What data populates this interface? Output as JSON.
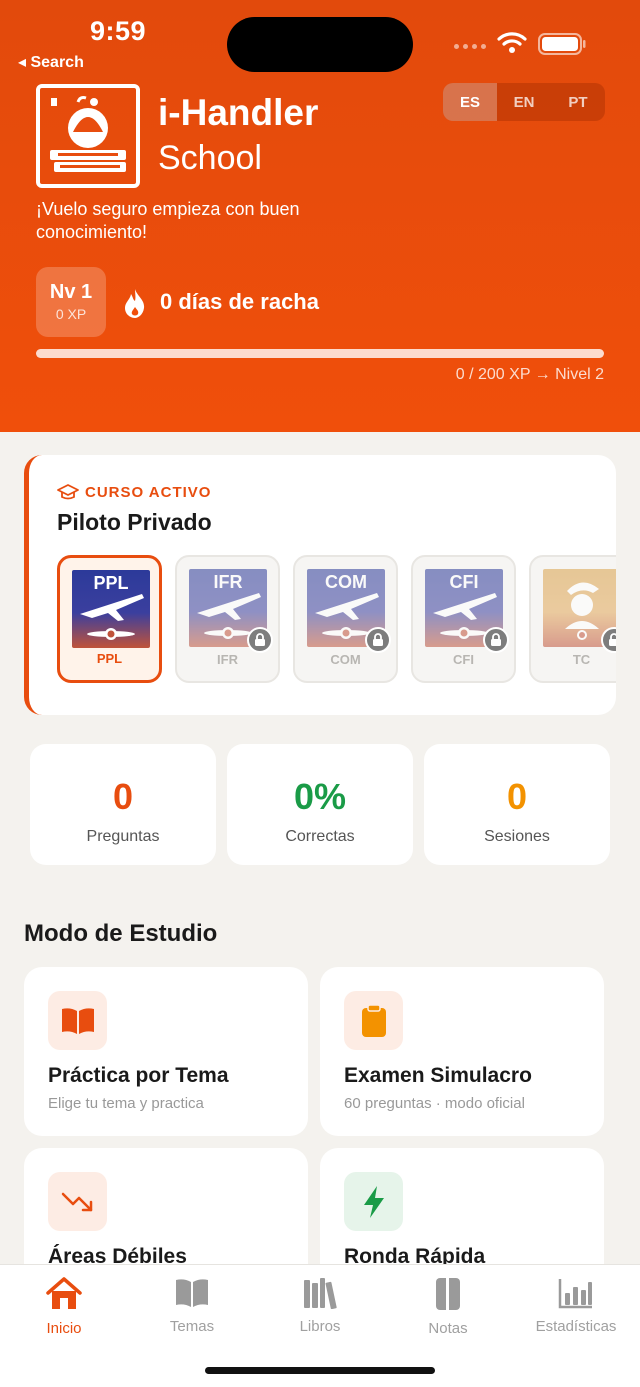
{
  "status": {
    "time": "9:59",
    "back_label": "◂ Search"
  },
  "header": {
    "app_name": "i-Handler",
    "app_sub": "School",
    "tagline": "¡Vuelo seguro empieza con buen conocimiento!",
    "languages": [
      "ES",
      "EN",
      "PT"
    ],
    "active_language": "ES",
    "level_label": "Nv 1",
    "level_xp": "0 XP",
    "streak": "0 días de racha",
    "xp_progress_fraction": 0.0,
    "xp_text": "0 / 200 XP → Nivel 2"
  },
  "course": {
    "kicker": "CURSO ACTIVO",
    "title": "Piloto Privado",
    "tiles": [
      {
        "code": "PPL",
        "label": "PPL",
        "active": true,
        "locked": false
      },
      {
        "code": "IFR",
        "label": "IFR",
        "active": false,
        "locked": true
      },
      {
        "code": "COM",
        "label": "COM",
        "active": false,
        "locked": true
      },
      {
        "code": "CFI",
        "label": "CFI",
        "active": false,
        "locked": true
      },
      {
        "code": "",
        "label": "TC",
        "active": false,
        "locked": true
      }
    ]
  },
  "stats": [
    {
      "value": "0",
      "label": "Preguntas",
      "color": "#e84d0f"
    },
    {
      "value": "0%",
      "label": "Correctas",
      "color": "#1a9b47"
    },
    {
      "value": "0",
      "label": "Sesiones",
      "color": "#f39200"
    }
  ],
  "study": {
    "section_title": "Modo de Estudio",
    "modes": [
      {
        "title": "Práctica por Tema",
        "sub": "Elige tu tema y practica",
        "icon": "book-icon"
      },
      {
        "title": "Examen Simulacro",
        "sub": "60 preguntas · modo oficial",
        "icon": "clipboard-icon"
      },
      {
        "title": "Áreas Débiles",
        "sub": "",
        "icon": "trend-down-icon"
      },
      {
        "title": "Ronda Rápida",
        "sub": "",
        "icon": "bolt-icon"
      }
    ]
  },
  "tabs": [
    {
      "label": "Inicio",
      "icon": "home-icon",
      "active": true
    },
    {
      "label": "Temas",
      "icon": "book-icon",
      "active": false
    },
    {
      "label": "Libros",
      "icon": "books-icon",
      "active": false
    },
    {
      "label": "Notas",
      "icon": "notes-icon",
      "active": false
    },
    {
      "label": "Estadísticas",
      "icon": "chart-icon",
      "active": false
    }
  ],
  "colors": {
    "brand": "#e84d0f",
    "green": "#1a9b47",
    "amber": "#f39200"
  }
}
